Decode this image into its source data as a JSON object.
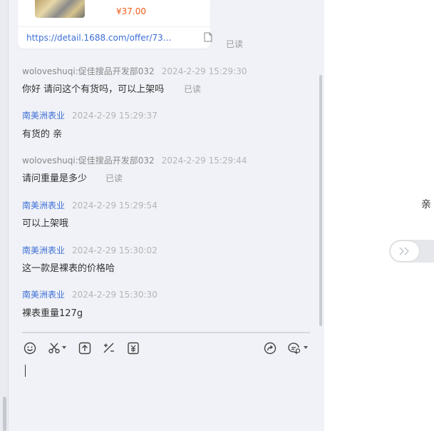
{
  "product_card": {
    "price": "¥37.00",
    "link_text": "https://detail.1688.com/offer/73...",
    "read_status": "已读"
  },
  "messages": [
    {
      "sender": "woloveshuqi:促佳搜品开发部032",
      "time": "2024-2-29 15:29:30",
      "text": "你好 请问这个有货吗，可以上架吗",
      "read": "已读"
    },
    {
      "sender": "南美洲表业",
      "time": "2024-2-29 15:29:37",
      "text": "有货的  亲"
    },
    {
      "sender": "woloveshuqi:促佳搜品开发部032",
      "time": "2024-2-29 15:29:44",
      "text": "请问重量是多少",
      "read": "已读"
    },
    {
      "sender": "南美洲表业",
      "time": "2024-2-29 15:29:54",
      "text": "可以上架哦"
    },
    {
      "sender": "南美洲表业",
      "time": "2024-2-29 15:30:02",
      "text": "这一款是裸表的价格哈"
    },
    {
      "sender": "南美洲表业",
      "time": "2024-2-29 15:30:30",
      "text": "裸表重量127g"
    }
  ],
  "toolbar": {
    "icons": [
      "emoji-icon",
      "scissors-icon",
      "upload-icon",
      "edit-icon",
      "coupon-icon",
      "share-icon",
      "quick-reply-icon"
    ]
  },
  "right_panel": {
    "qin_text": "亲"
  },
  "colors": {
    "link": "#3d6fd6",
    "price": "#f25c19",
    "panel_bg": "#f0f2f7"
  }
}
